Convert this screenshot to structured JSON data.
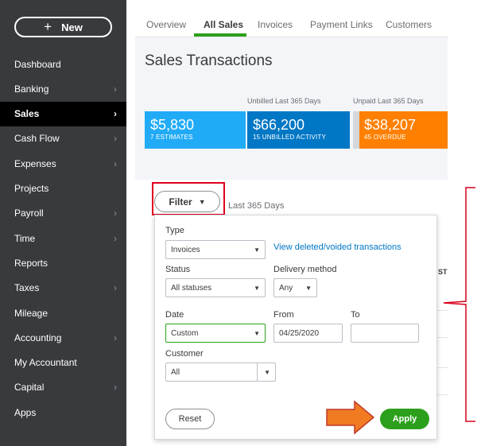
{
  "sidebar": {
    "new_label": "New",
    "items": [
      {
        "label": "Dashboard",
        "chevron": false
      },
      {
        "label": "Banking",
        "chevron": true
      },
      {
        "label": "Sales",
        "chevron": true,
        "active": true
      },
      {
        "label": "Cash Flow",
        "chevron": true
      },
      {
        "label": "Expenses",
        "chevron": true
      },
      {
        "label": "Projects",
        "chevron": false
      },
      {
        "label": "Payroll",
        "chevron": true
      },
      {
        "label": "Time",
        "chevron": true
      },
      {
        "label": "Reports",
        "chevron": false
      },
      {
        "label": "Taxes",
        "chevron": true
      },
      {
        "label": "Mileage",
        "chevron": false
      },
      {
        "label": "Accounting",
        "chevron": true
      },
      {
        "label": "My Accountant",
        "chevron": false
      },
      {
        "label": "Capital",
        "chevron": true
      },
      {
        "label": "Apps",
        "chevron": false
      }
    ]
  },
  "tabs": [
    "Overview",
    "All Sales",
    "Invoices",
    "Payment Links",
    "Customers"
  ],
  "active_tab": "All Sales",
  "page_title": "Sales Transactions",
  "summary": {
    "unbilled_label": "Unbilled Last 365 Days",
    "unpaid_label": "Unpaid Last 365 Days",
    "cards": [
      {
        "amount": "$5,830",
        "caption": "7 ESTIMATES",
        "color": "#21abf6"
      },
      {
        "amount": "$66,200",
        "caption": "15 UNBILLED ACTIVITY",
        "color": "#0077c5"
      },
      {
        "amount": "$38,207",
        "caption": "45 OVERDUE",
        "color": "#ff8000"
      }
    ]
  },
  "filter": {
    "button_label": "Filter",
    "date_range_text": "Last 365 Days",
    "column_header_fragment": "ST",
    "type_label": "Type",
    "type_value": "Invoices",
    "view_deleted_link": "View deleted/voided transactions",
    "status_label": "Status",
    "status_value": "All statuses",
    "delivery_label": "Delivery method",
    "delivery_value": "Any",
    "date_label": "Date",
    "date_value": "Custom",
    "from_label": "From",
    "from_value": "04/25/2020",
    "to_label": "To",
    "to_value": "",
    "customer_label": "Customer",
    "customer_value": "All",
    "reset_label": "Reset",
    "apply_label": "Apply"
  },
  "colors": {
    "sidebar_bg": "#393a3d",
    "brand_green": "#2ca01c",
    "highlight_red": "#e0001b",
    "annotation_arrow": "#f07b22"
  }
}
